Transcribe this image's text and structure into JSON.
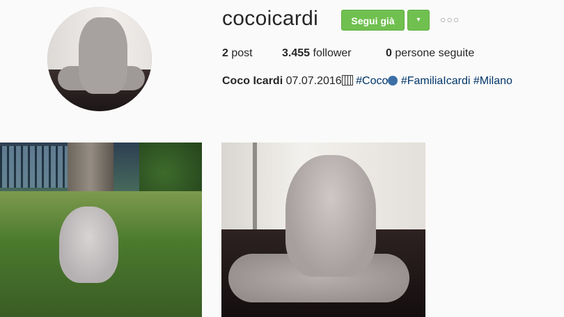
{
  "profile": {
    "username": "cocoicardi",
    "follow_button_label": "Segui già",
    "dropdown_symbol": "▾",
    "more_symbol": "○○○",
    "stats": {
      "posts_count": "2",
      "posts_label": "post",
      "followers_count": "3.455",
      "followers_label": "follower",
      "following_count": "0",
      "following_label": "persone seguite"
    },
    "bio": {
      "name": "Coco Icardi",
      "text": "07.07.2016",
      "tag1": "#Coco",
      "tag2": "#FamiliaIcardi",
      "tag3": "#Milano"
    }
  },
  "colors": {
    "follow_green": "#70c050",
    "hashtag_blue": "#003569",
    "background": "#fafafa"
  },
  "posts": [
    {
      "subject": "weimaraner puppy in grass"
    },
    {
      "subject": "weimaraner puppy lying on floor"
    }
  ]
}
